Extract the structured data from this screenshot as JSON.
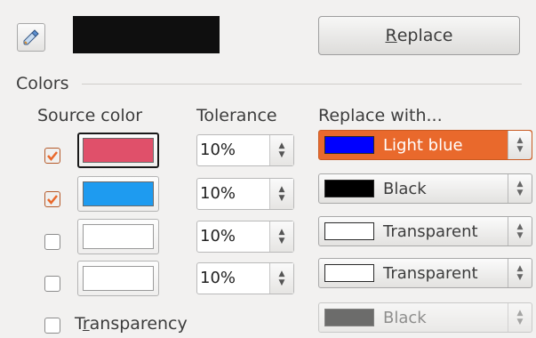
{
  "toolbar": {
    "pipette_icon": "pipette-icon",
    "preview_color": "#0f0f0f",
    "replace_button": {
      "pre": "",
      "accel": "R",
      "post": "eplace"
    }
  },
  "colors_section": {
    "title": "Colors",
    "headers": {
      "source": "Source color",
      "tolerance": "Tolerance",
      "replace_with": "Replace with..."
    },
    "rows": [
      {
        "checked": true,
        "source_color": "#e0506a",
        "tolerance": "10%",
        "replace_name": "Light blue",
        "replace_color": "#0000ff",
        "focused": true
      },
      {
        "checked": true,
        "source_color": "#1e9bf0",
        "tolerance": "10%",
        "replace_name": "Black",
        "replace_color": "#000000",
        "focused": false
      },
      {
        "checked": false,
        "source_color": "#ffffff",
        "tolerance": "10%",
        "replace_name": "Transparent",
        "replace_color": "#ffffff",
        "focused": false
      },
      {
        "checked": false,
        "source_color": "#ffffff",
        "tolerance": "10%",
        "replace_name": "Transparent",
        "replace_color": "#ffffff",
        "focused": false
      }
    ],
    "transparency": {
      "checked": false,
      "label_pre": "T",
      "label_accel": "r",
      "label_post": "ansparency",
      "replace_name": "Black",
      "replace_color": "#000000"
    }
  },
  "accent_color": "#e9692c"
}
